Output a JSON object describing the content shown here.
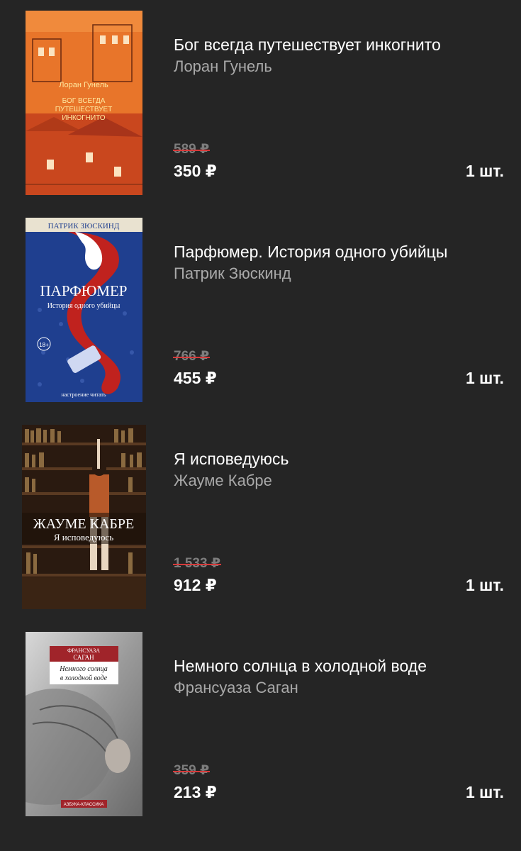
{
  "cart": {
    "items": [
      {
        "cover_alt": "Бог всегда путешествует инкогнито",
        "cover_text": [
          "Лоран Гунель",
          "БОГ ВСЕГДА",
          "ПУТЕШЕСТВУЕТ",
          "ИНКОГНИТО"
        ],
        "title": "Бог всегда путешествует инкогнито",
        "author": "Лоран Гунель",
        "old_price": "589 ₽",
        "price": "350 ₽",
        "quantity": "1 шт."
      },
      {
        "cover_alt": "Парфюмер",
        "cover_text": [
          "ПАТРИК ЗЮСКИНД",
          "ПАРФЮМЕР",
          "История одного убийцы",
          "18+",
          "настроение читать"
        ],
        "title": "Парфюмер. История одного убийцы",
        "author": "Патрик Зюскинд",
        "old_price": "766 ₽",
        "price": "455 ₽",
        "quantity": "1 шт."
      },
      {
        "cover_alt": "Я исповедуюсь",
        "cover_text": [
          "ЖАУМЕ КАБРЕ",
          "Я исповедуюсь"
        ],
        "title": "Я исповедуюсь",
        "author": "Жауме Кабре",
        "old_price": "1 533 ₽",
        "price": "912 ₽",
        "quantity": "1 шт."
      },
      {
        "cover_alt": "Немного солнца в холодной воде",
        "cover_text": [
          "ФРАНСУАЗА",
          "САГАН",
          "Немного солнца",
          "в холодной воде",
          "АЗБУКА-КЛАССИКА"
        ],
        "title": "Немного солнца в холодной воде",
        "author": "Франсуаза Саган",
        "old_price": "359 ₽",
        "price": "213 ₽",
        "quantity": "1 шт."
      }
    ]
  },
  "colors": {
    "background": "#252525",
    "text": "#ffffff",
    "author_text": "#a9a9a9",
    "old_price_text": "#7d7d7d",
    "strike": "#d63a3a"
  }
}
